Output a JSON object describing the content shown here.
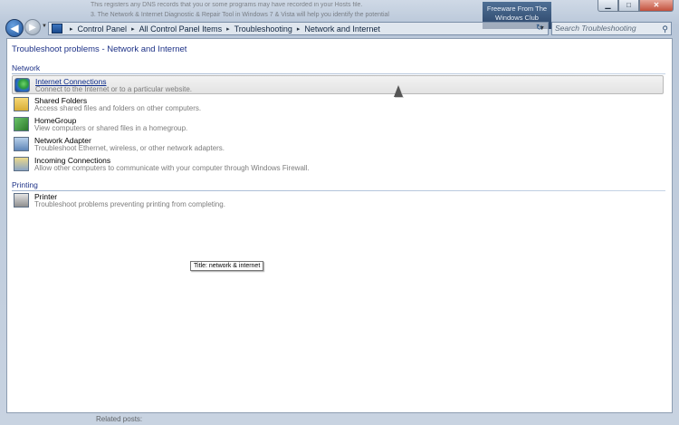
{
  "background": {
    "doc_lines": [
      "This registers any DNS records that you or some programs may have recorded in your Hosts file.",
      "",
      "3. The Network & Internet Diagnostic & Repair Tool in Windows 7 & Vista will help you identify the potential"
    ],
    "badge": "Freeware From The Windows Club",
    "bottom_text": "Related posts:"
  },
  "window_buttons": {
    "minimize": "▁",
    "maximize": "□",
    "close": "✕"
  },
  "nav": {
    "back": "◀",
    "forward": "▶",
    "dropdown": "▼"
  },
  "address": {
    "crumbs": [
      "Control Panel",
      "All Control Panel Items",
      "Troubleshooting",
      "Network and Internet"
    ],
    "separator": "▸",
    "dropdown": "▼",
    "refresh": "↻"
  },
  "search": {
    "placeholder": "Search Troubleshooting",
    "icon": "⚲"
  },
  "content": {
    "title": "Troubleshoot problems - Network and Internet",
    "groups": [
      {
        "label": "Network",
        "items": [
          {
            "name": "Internet Connections",
            "desc": "Connect to the Internet or to a particular website.",
            "icon": "globe-icon"
          },
          {
            "name": "Shared Folders",
            "desc": "Access shared files and folders on other computers.",
            "icon": "folder-icon"
          },
          {
            "name": "HomeGroup",
            "desc": "View computers or shared files in a homegroup.",
            "icon": "homegroup-icon"
          },
          {
            "name": "Network Adapter",
            "desc": "Troubleshoot Ethernet, wireless, or other network adapters.",
            "icon": "network-adapter-icon"
          },
          {
            "name": "Incoming Connections",
            "desc": "Allow other computers to communicate with your computer through Windows Firewall.",
            "icon": "incoming-connections-icon"
          }
        ]
      },
      {
        "label": "Printing",
        "items": [
          {
            "name": "Printer",
            "desc": "Troubleshoot problems preventing printing from completing.",
            "icon": "printer-icon"
          }
        ]
      }
    ],
    "tooltip": "Title: network & internet"
  },
  "colors": {
    "heading": "#1e3287",
    "description": "#7c7c7c",
    "highlight_row": "#e8e8e8"
  }
}
